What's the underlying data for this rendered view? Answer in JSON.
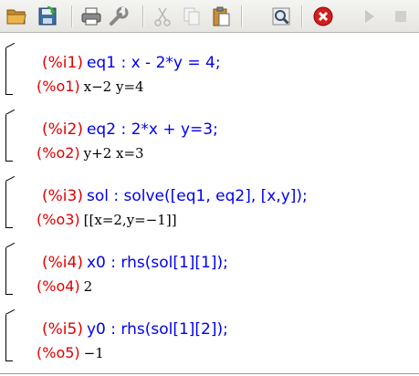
{
  "toolbar": {
    "buttons": [
      {
        "icon": "open-folder-icon"
      },
      {
        "icon": "save-icon"
      },
      {
        "icon": "print-icon"
      },
      {
        "icon": "configure-icon"
      },
      {
        "icon": "cut-icon"
      },
      {
        "icon": "copy-icon"
      },
      {
        "icon": "paste-icon"
      },
      {
        "icon": "find-icon"
      },
      {
        "icon": "interrupt-icon"
      },
      {
        "icon": "play-icon"
      },
      {
        "icon": "stop-icon"
      }
    ]
  },
  "cells": [
    {
      "in_label": "(%i1)",
      "in_code": "eq1 : x - 2*y = 4;",
      "out_label": "(%o1)",
      "out_text": "x−2 y=4"
    },
    {
      "in_label": "(%i2)",
      "in_code": "eq2 : 2*x + y=3;",
      "out_label": "(%o2)",
      "out_text": "y+2 x=3"
    },
    {
      "in_label": "(%i3)",
      "in_code": "sol : solve([eq1, eq2], [x,y]);",
      "out_label": "(%o3)",
      "out_text": "[[x=2,y=−1]]"
    },
    {
      "in_label": "(%i4)",
      "in_code": "x0 : rhs(sol[1][1]);",
      "out_label": "(%o4)",
      "out_text": "2"
    },
    {
      "in_label": "(%i5)",
      "in_code": "y0 : rhs(sol[1][2]);",
      "out_label": "(%o5)",
      "out_text": "−1"
    }
  ],
  "colors": {
    "input_label": "#e00000",
    "input_code": "#0000ee",
    "output_label": "#e00000",
    "output_math": "#000000"
  }
}
